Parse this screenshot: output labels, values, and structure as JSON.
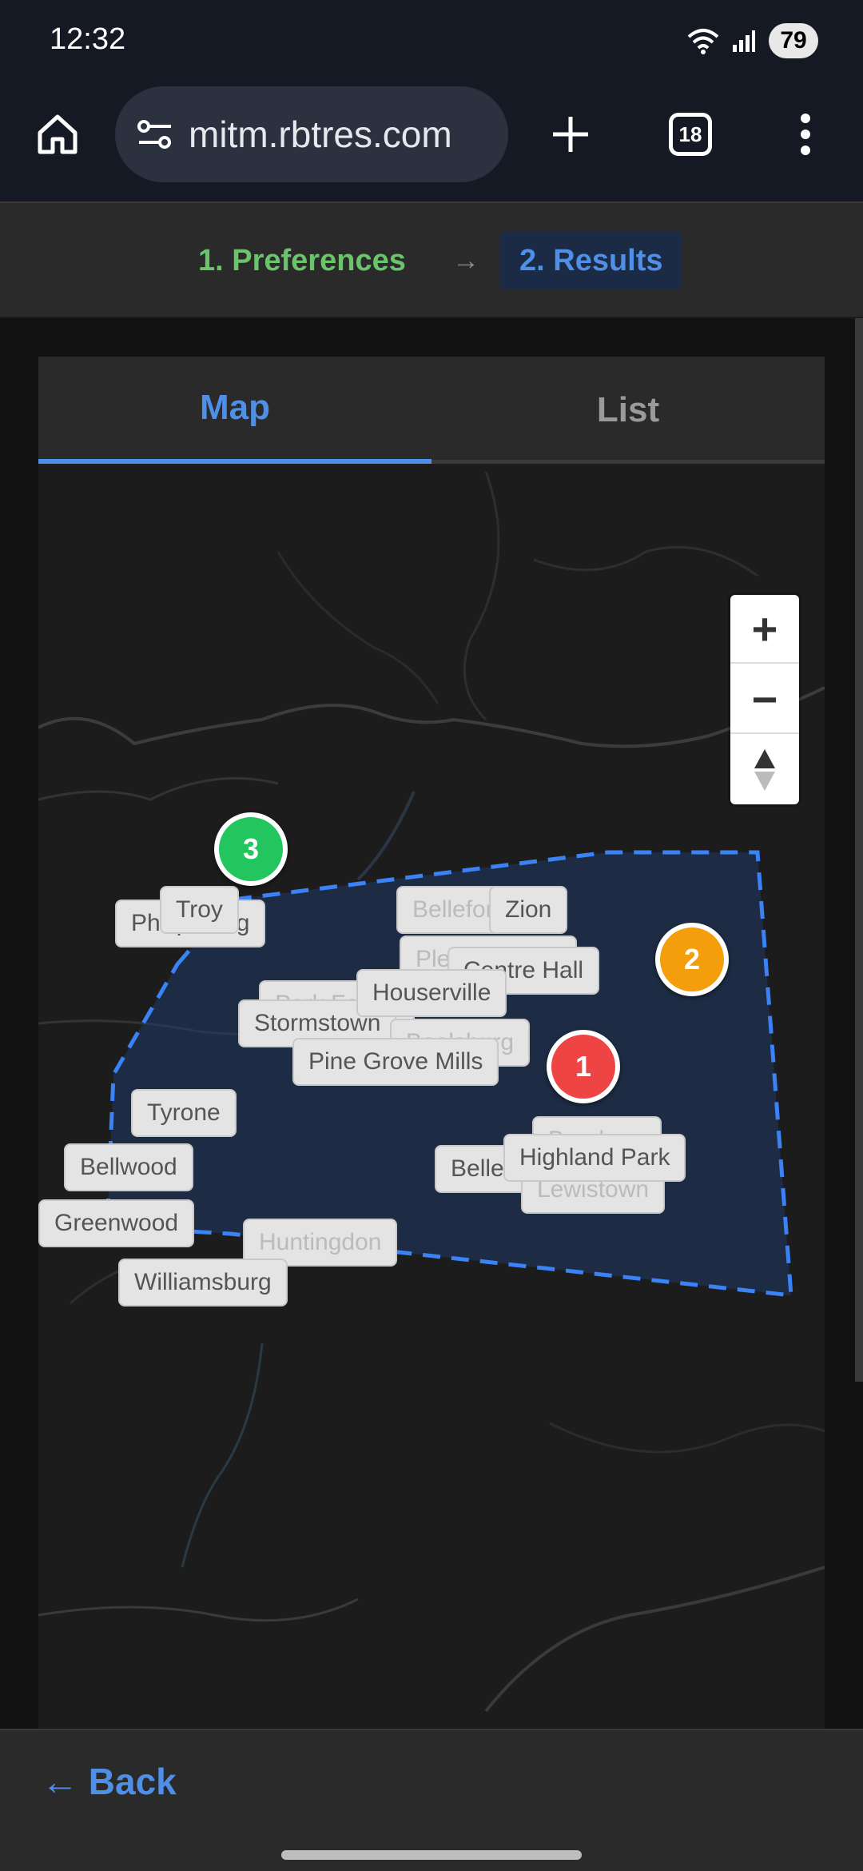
{
  "status_bar": {
    "time": "12:32",
    "battery": "79"
  },
  "browser": {
    "url": "mitm.rbtres.com",
    "tab_count": "18"
  },
  "steps": {
    "step1": "1. Preferences",
    "arrow": "→",
    "step2": "2. Results"
  },
  "tabs": {
    "map": "Map",
    "list": "List"
  },
  "map": {
    "zoom_in": "+",
    "zoom_out": "−",
    "towns": [
      "Troy",
      "Philipsburg",
      "Bellefonte",
      "Zion",
      "Pleasant Gap",
      "Centre Hall",
      "Park Forest",
      "Houserville",
      "Stormstown",
      "Boalsburg",
      "Pine Grove Mills",
      "Tyrone",
      "Bellwood",
      "Greenwood",
      "Huntingdon",
      "Williamsburg",
      "Belleville",
      "Burnham",
      "Lewistown",
      "Highland Park"
    ],
    "markers": [
      {
        "label": "3",
        "color": "#22c55e"
      },
      {
        "label": "2",
        "color": "#f59e0b"
      },
      {
        "label": "1",
        "color": "#ef4444"
      }
    ]
  },
  "footer": {
    "back_label": "← Back"
  },
  "colors": {
    "accent": "#4f8fe6",
    "step_done": "#6bc46b",
    "region": "#1f3b66"
  }
}
